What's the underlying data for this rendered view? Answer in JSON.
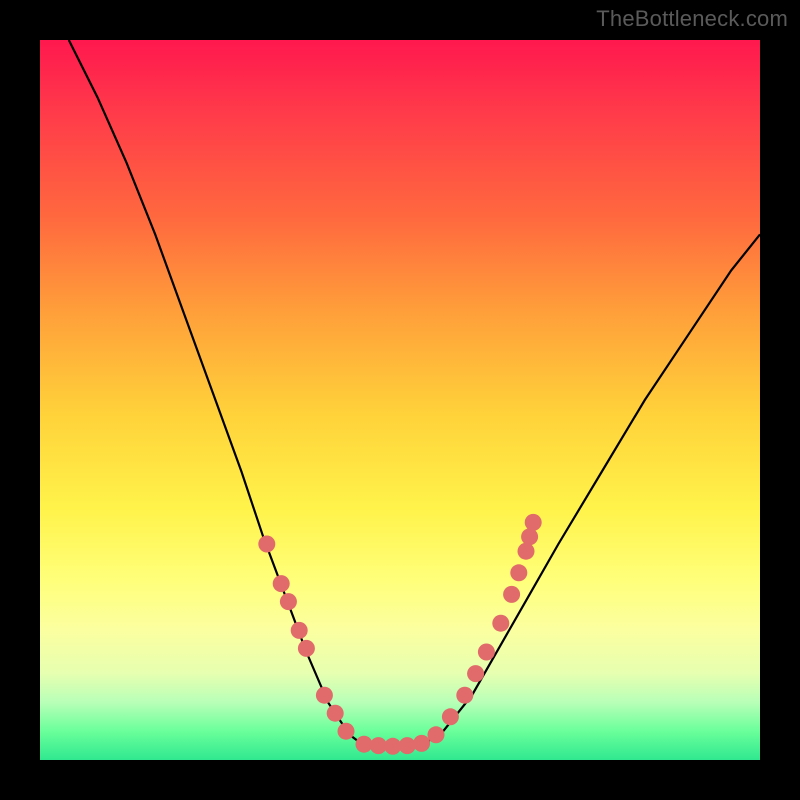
{
  "attribution": "TheBottleneck.com",
  "chart_data": {
    "type": "line",
    "title": "",
    "xlabel": "",
    "ylabel": "",
    "xlim": [
      0,
      100
    ],
    "ylim": [
      0,
      100
    ],
    "curve": {
      "left_segment": [
        {
          "x": 4,
          "y": 100
        },
        {
          "x": 8,
          "y": 92
        },
        {
          "x": 12,
          "y": 83
        },
        {
          "x": 16,
          "y": 73
        },
        {
          "x": 20,
          "y": 62
        },
        {
          "x": 24,
          "y": 51
        },
        {
          "x": 28,
          "y": 40
        },
        {
          "x": 31,
          "y": 31
        },
        {
          "x": 34,
          "y": 23
        },
        {
          "x": 37,
          "y": 15
        },
        {
          "x": 40,
          "y": 8
        },
        {
          "x": 43,
          "y": 3.5
        },
        {
          "x": 45,
          "y": 2
        }
      ],
      "bottom_segment": [
        {
          "x": 45,
          "y": 2
        },
        {
          "x": 48,
          "y": 1.8
        },
        {
          "x": 51,
          "y": 1.8
        },
        {
          "x": 53,
          "y": 2
        }
      ],
      "right_segment": [
        {
          "x": 53,
          "y": 2
        },
        {
          "x": 56,
          "y": 4
        },
        {
          "x": 60,
          "y": 9
        },
        {
          "x": 64,
          "y": 16
        },
        {
          "x": 68,
          "y": 23
        },
        {
          "x": 72,
          "y": 30
        },
        {
          "x": 78,
          "y": 40
        },
        {
          "x": 84,
          "y": 50
        },
        {
          "x": 90,
          "y": 59
        },
        {
          "x": 96,
          "y": 68
        },
        {
          "x": 100,
          "y": 73
        }
      ]
    },
    "markers_left": [
      {
        "x": 31.5,
        "y": 30
      },
      {
        "x": 33.5,
        "y": 24.5
      },
      {
        "x": 34.5,
        "y": 22
      },
      {
        "x": 36,
        "y": 18
      },
      {
        "x": 37,
        "y": 15.5
      },
      {
        "x": 39.5,
        "y": 9
      },
      {
        "x": 41,
        "y": 6.5
      },
      {
        "x": 42.5,
        "y": 4
      }
    ],
    "markers_bottom": [
      {
        "x": 45,
        "y": 2.2
      },
      {
        "x": 47,
        "y": 2
      },
      {
        "x": 49,
        "y": 1.9
      },
      {
        "x": 51,
        "y": 2
      },
      {
        "x": 53,
        "y": 2.3
      }
    ],
    "markers_right": [
      {
        "x": 55,
        "y": 3.5
      },
      {
        "x": 57,
        "y": 6
      },
      {
        "x": 59,
        "y": 9
      },
      {
        "x": 60.5,
        "y": 12
      },
      {
        "x": 62,
        "y": 15
      },
      {
        "x": 64,
        "y": 19
      },
      {
        "x": 65.5,
        "y": 23
      },
      {
        "x": 66.5,
        "y": 26
      },
      {
        "x": 67.5,
        "y": 29
      },
      {
        "x": 68,
        "y": 31
      },
      {
        "x": 68.5,
        "y": 33
      }
    ],
    "marker_color": "#e16a6a",
    "curve_color": "#000000"
  }
}
